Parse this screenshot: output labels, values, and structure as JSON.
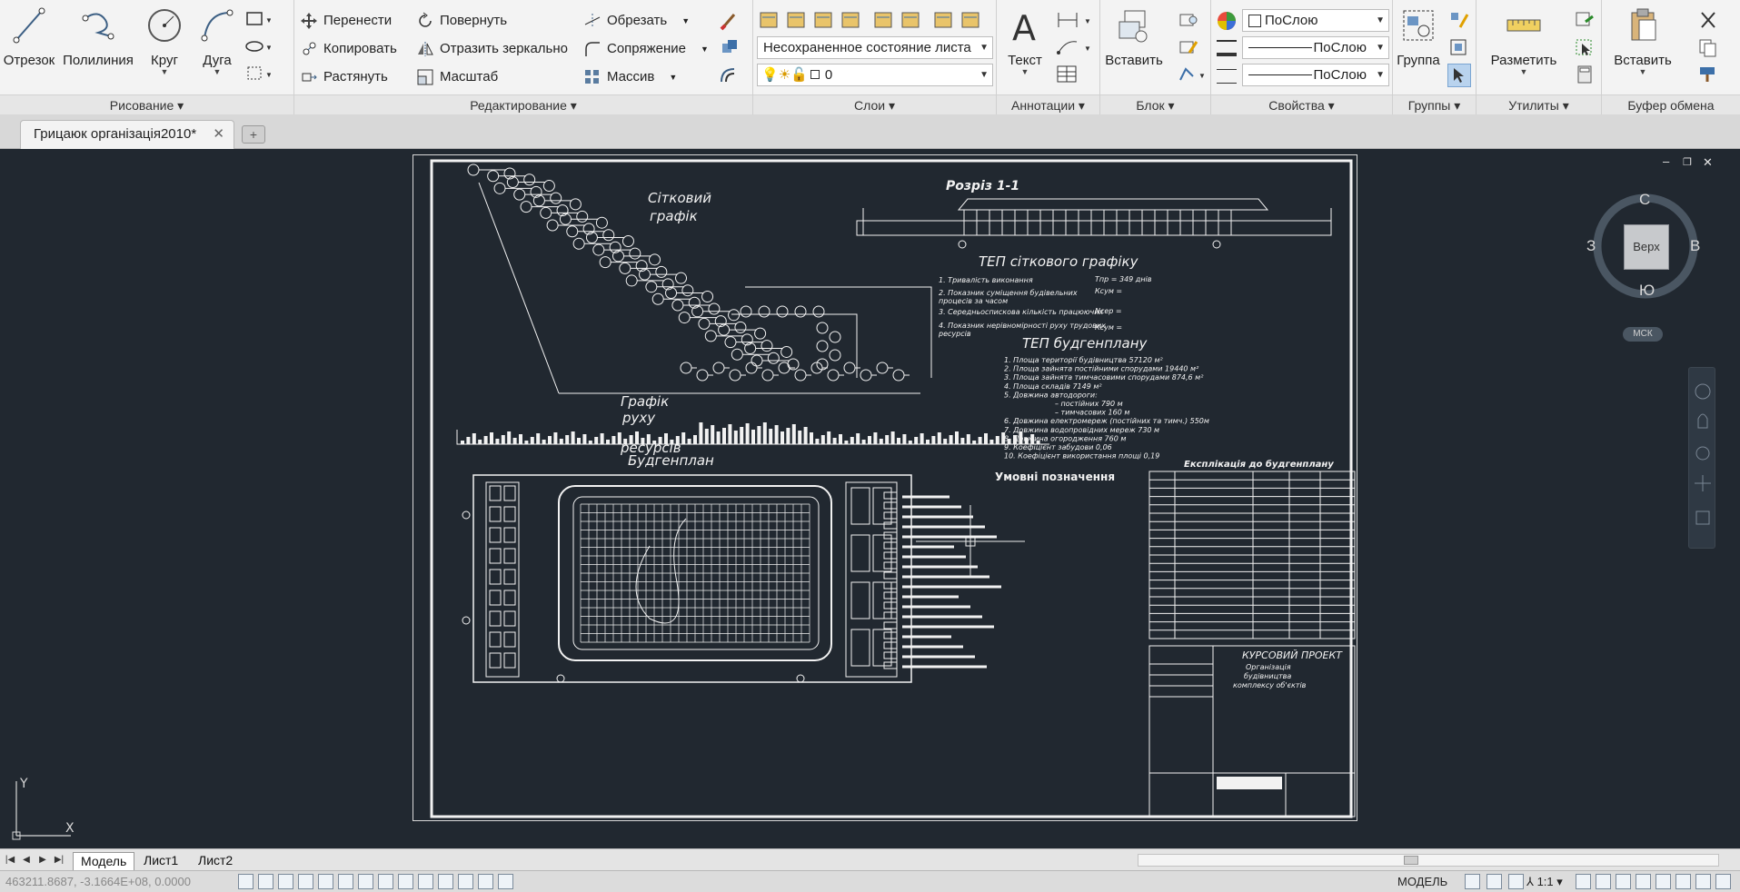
{
  "ribbon": {
    "draw": {
      "title": "Рисование",
      "line": "Отрезок",
      "polyline": "Полилиния",
      "circle": "Круг",
      "arc": "Дуга"
    },
    "modify": {
      "title": "Редактирование",
      "move": "Перенести",
      "copy": "Копировать",
      "stretch": "Растянуть",
      "rotate": "Повернуть",
      "mirror": "Отразить зеркально",
      "scale": "Масштаб",
      "trim": "Обрезать",
      "fillet": "Сопряжение",
      "array": "Массив"
    },
    "layers": {
      "title": "Слои",
      "layer_state": "Несохраненное состояние листа",
      "current_layer": "0"
    },
    "annotation": {
      "title": "Аннотации",
      "text": "Текст"
    },
    "block": {
      "title": "Блок",
      "insert": "Вставить"
    },
    "properties": {
      "title": "Свойства",
      "color": "ПоСлою",
      "linetype": "ПоСлою",
      "lineweight": "ПоСлою"
    },
    "groups": {
      "title": "Группы",
      "group": "Группа"
    },
    "utilities": {
      "title": "Утилиты",
      "measure": "Разметить"
    },
    "clipboard": {
      "title": "Буфер обмена",
      "paste": "Вставить"
    }
  },
  "document_tab": {
    "name": "Грицаюк організація2010*"
  },
  "drawing": {
    "network_title_1": "Сітковий",
    "network_title_2": "графік",
    "section_title": "Розріз 1-1",
    "tep_network_title": "ТЕП сіткового графіку",
    "tep_network_items": [
      "1. Тривалість виконання",
      "2. Показник суміщення будівельних",
      "процесів за часом",
      "3. Середньоспискова кількість працюючих",
      "4. Показник нерівномірності руху трудових",
      "ресурсів"
    ],
    "tep_network_values": [
      "Тпр = 349 днів",
      "Ксум = ",
      "Nсер = ",
      "Ксум = "
    ],
    "tep_site_title": "ТЕП будгенплану",
    "tep_site_items": [
      "1. Площа території будівництва  57120 м²",
      "2. Площа зайнята постійними спорудами  19440 м²",
      "3. Площа зайнята тимчасовими спорудами 874,6 м²",
      "4. Площа складів  7149 м²",
      "5. Довжина автодороги:",
      "– постійних 790 м",
      "– тимчасових 160 м",
      "6. Довжина електромереж (постійних та тимч.) 550м",
      "7. Довжина водопровідних мереж  730 м",
      "8. Довжина огородження  760 м",
      "9. Коефіцієнт забудови  0,06",
      "10. Коефіцієнт використання площі  0,19"
    ],
    "resource_title_1": "Графік",
    "resource_title_2": "руху",
    "resource_title_3": "ресурсів",
    "site_plan_title": "Будгенплан",
    "legend_title": "Умовні позначення",
    "explication_title": "Експлікація до будгенплану",
    "stamp_title": "КУРСОВИЙ ПРОЕКТ",
    "stamp_subtitle_1": "Організація",
    "stamp_subtitle_2": "будівництва",
    "stamp_subtitle_3": "комплексу об'єктів"
  },
  "viewcube": {
    "top": "Верх",
    "north": "С",
    "south": "Ю",
    "east": "В",
    "west": "З",
    "ucs": "МСК"
  },
  "layout_tabs": [
    "Модель",
    "Лист1",
    "Лист2"
  ],
  "status": {
    "coords": "463211.8687, -3.1664E+08, 0.0000",
    "mode": "МОДЕЛЬ",
    "scale": "1:1"
  }
}
